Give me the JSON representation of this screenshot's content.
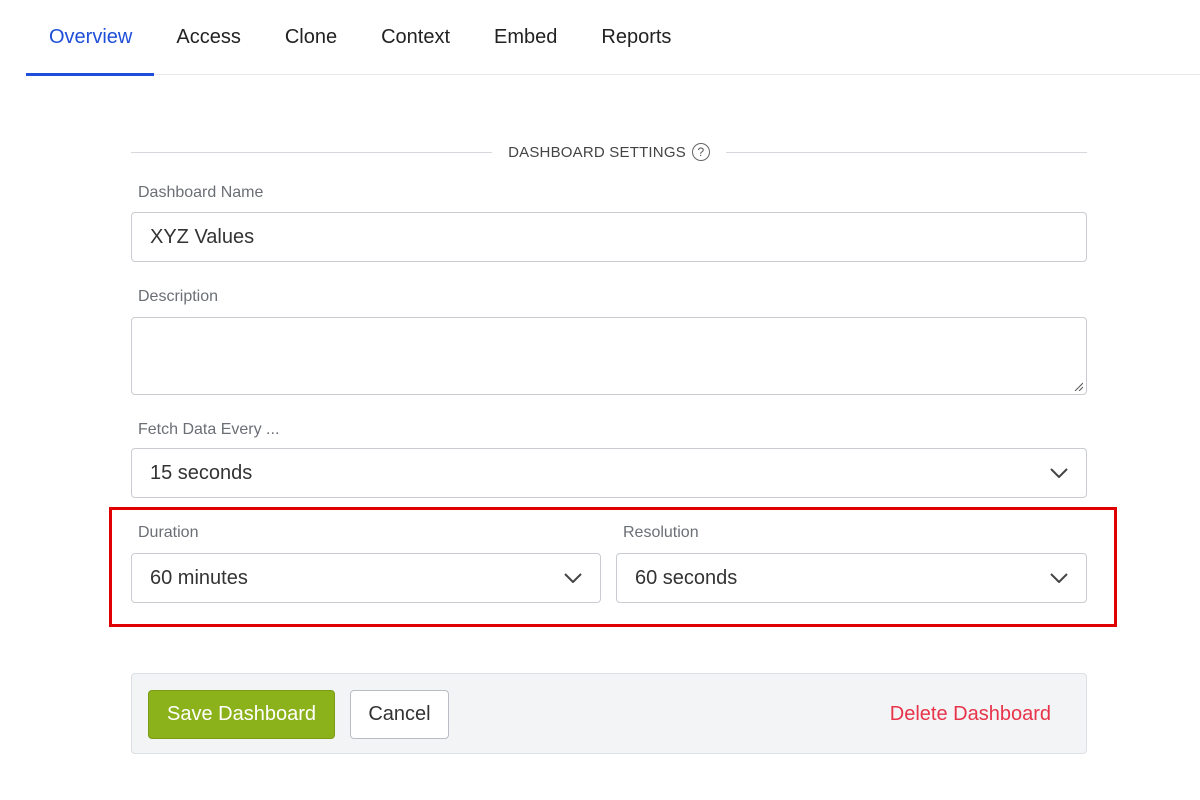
{
  "tabs": [
    {
      "label": "Overview",
      "active": true
    },
    {
      "label": "Access"
    },
    {
      "label": "Clone"
    },
    {
      "label": "Context"
    },
    {
      "label": "Embed"
    },
    {
      "label": "Reports"
    }
  ],
  "section": {
    "title": "DASHBOARD SETTINGS",
    "help_glyph": "?"
  },
  "form": {
    "name_label": "Dashboard Name",
    "name_value": "XYZ Values",
    "description_label": "Description",
    "description_value": "",
    "fetch_label": "Fetch Data Every ...",
    "fetch_value": "15 seconds",
    "duration_label": "Duration",
    "duration_value": "60 minutes",
    "resolution_label": "Resolution",
    "resolution_value": "60 seconds"
  },
  "actions": {
    "save_label": "Save Dashboard",
    "cancel_label": "Cancel",
    "delete_label": "Delete Dashboard"
  },
  "colors": {
    "accent": "#1f4fd8",
    "save": "#8cb21b",
    "delete": "#e8344a",
    "highlight": "#e00000"
  }
}
